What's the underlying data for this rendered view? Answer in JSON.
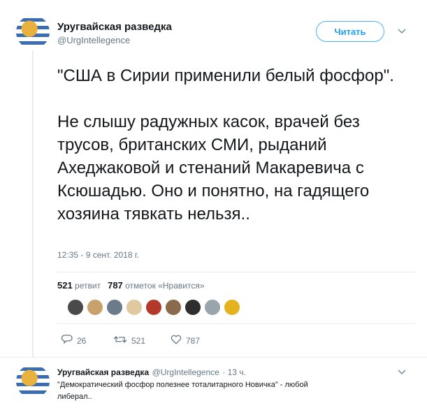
{
  "tweet": {
    "author_name": "Уругвайская разведка",
    "author_handle": "@UrgIntellegence",
    "follow_label": "Читать",
    "text": "\"США в Сирии применили белый фосфор\".\n\nНе слышу радужных касок, врачей без трусов, британских СМИ, рыданий Ахеджаковой и стенаний Макаревича с Ксюшадью. Оно и понятно, на гадящего хозяина тявкать нельзя..",
    "timestamp": "12:35 - 9 сент. 2018 г.",
    "retweets_count": "521",
    "retweets_label": "ретвит",
    "likes_count": "787",
    "likes_label": "отметок «Нравится»",
    "likers": [
      {
        "icon": "liker-avatar-1",
        "color": "#4a4a4a"
      },
      {
        "icon": "liker-avatar-2",
        "color": "#c9a26b"
      },
      {
        "icon": "liker-avatar-3",
        "color": "#6b7b8c"
      },
      {
        "icon": "liker-avatar-4",
        "color": "#e0c9a0"
      },
      {
        "icon": "liker-avatar-5",
        "color": "#b33a2a"
      },
      {
        "icon": "liker-avatar-6",
        "color": "#8a6a4a"
      },
      {
        "icon": "liker-avatar-7",
        "color": "#2e2e2e"
      },
      {
        "icon": "liker-avatar-8",
        "color": "#9aa4ad"
      },
      {
        "icon": "liker-avatar-9",
        "color": "#e3b21c"
      }
    ],
    "actions": {
      "replies": "26",
      "retweets": "521",
      "likes": "787"
    }
  },
  "reply": {
    "author_name": "Уругвайская разведка",
    "author_handle": "@UrgIntellegence",
    "time": "· 13 ч.",
    "text": "\"Демократический фосфор полезнее тоталитарного Новичка\" - любой\nлиберал.."
  }
}
